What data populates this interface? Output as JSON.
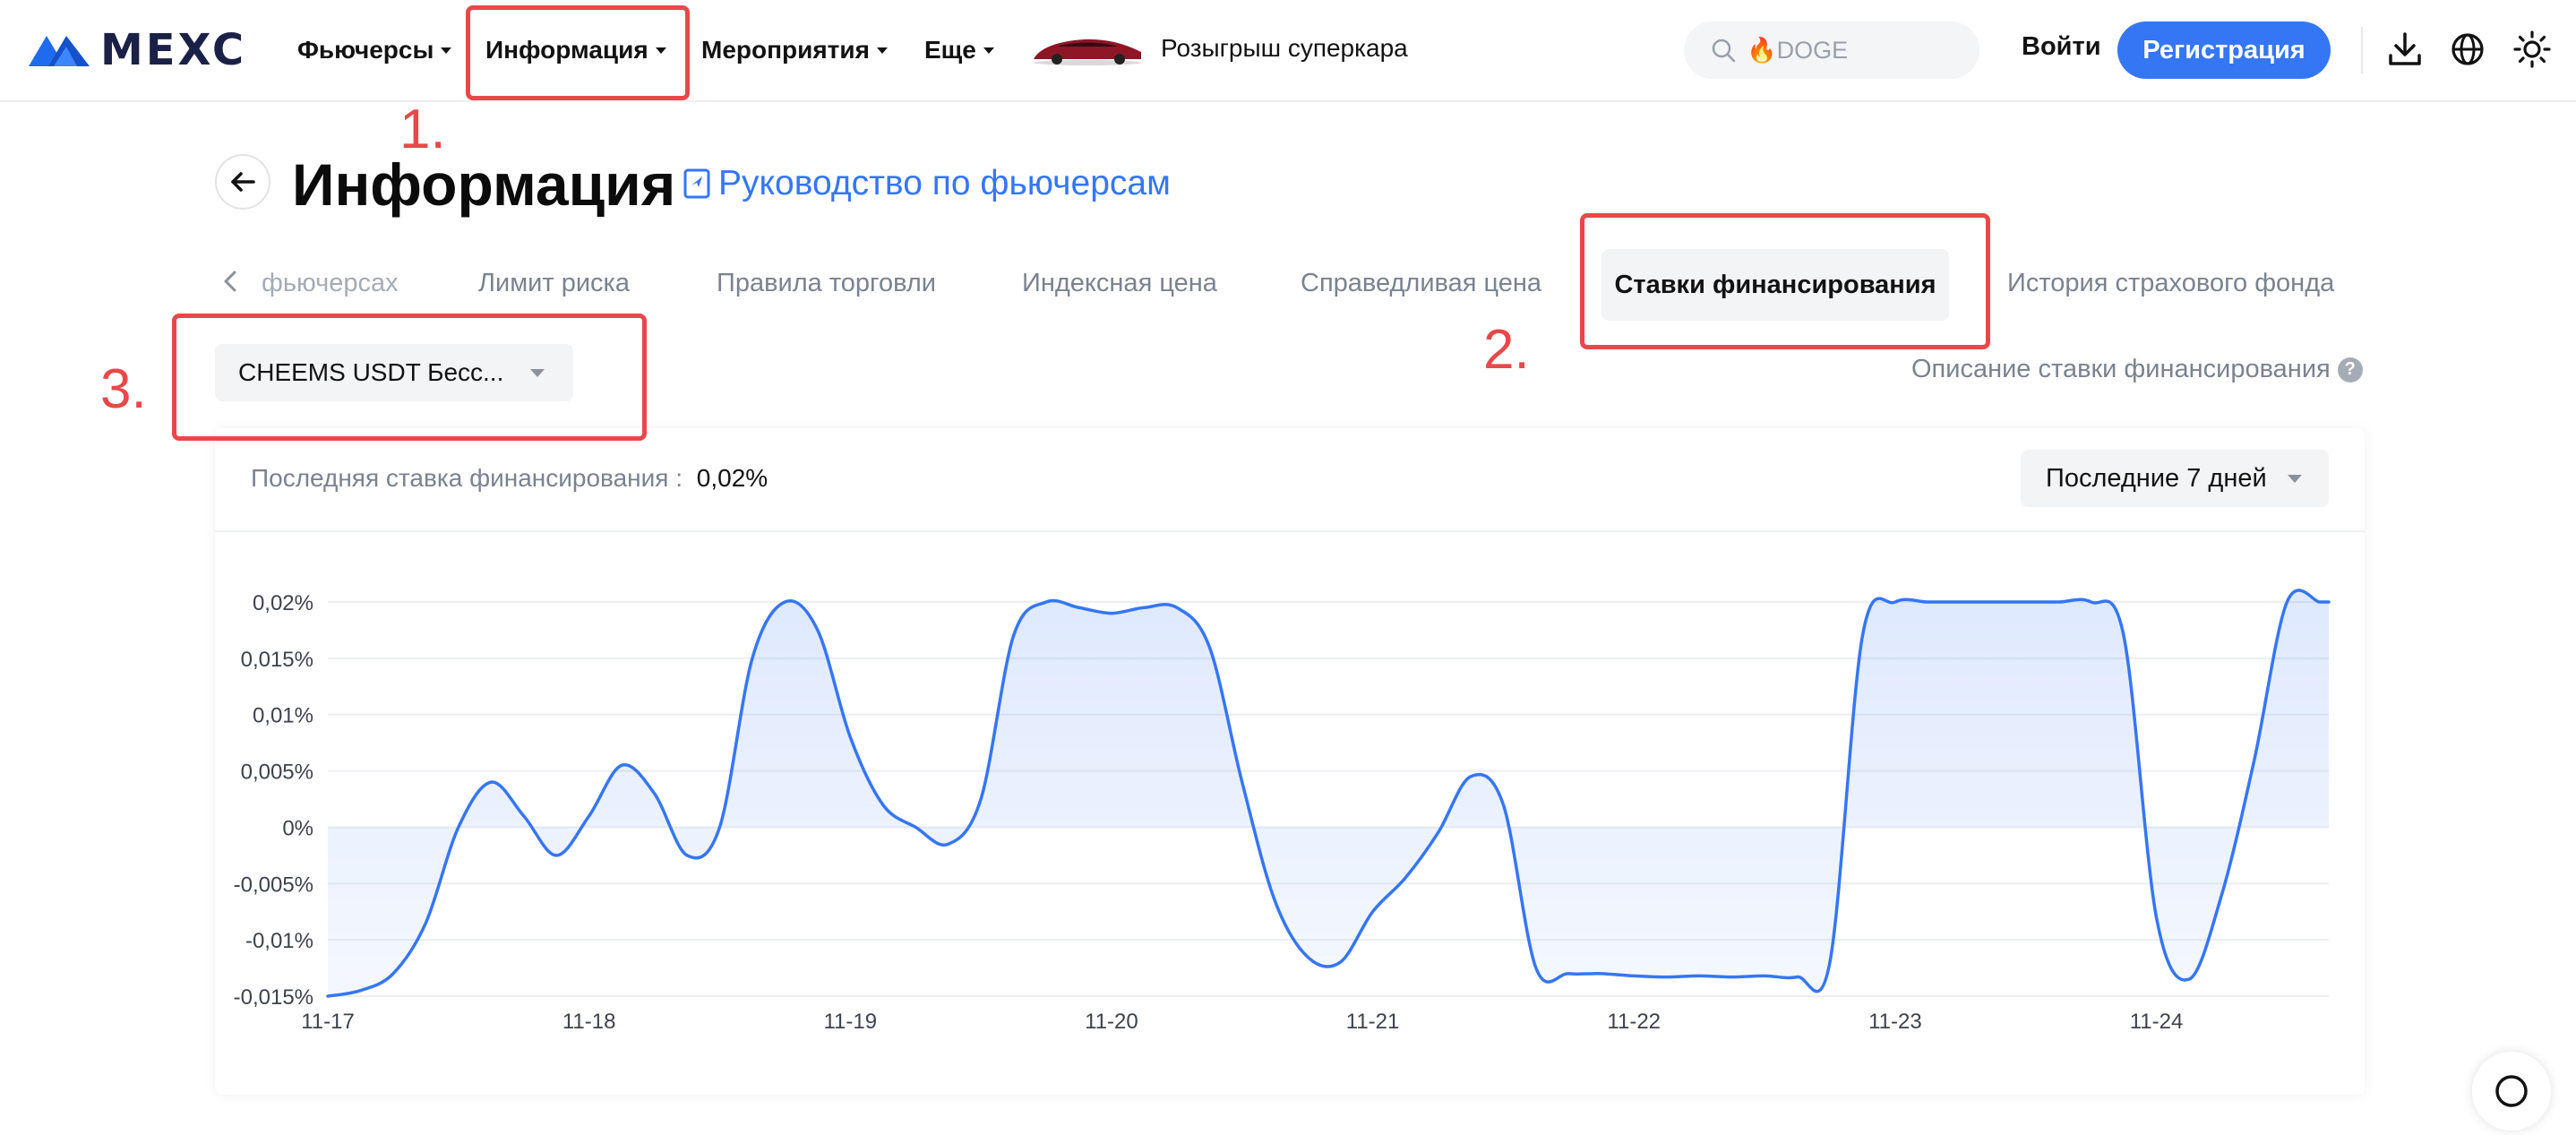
{
  "brand": {
    "logo_text": "MEXC",
    "accent": "#3576f5",
    "annotation_color": "#e8484a"
  },
  "nav": {
    "items": [
      {
        "label": "Фьючерсы"
      },
      {
        "label": "Информация"
      },
      {
        "label": "Мероприятия"
      },
      {
        "label": "Еще"
      }
    ],
    "promo_label": "Розыгрыш суперкара",
    "search_placeholder": "🔥DOGE",
    "login_label": "Войти",
    "register_label": "Регистрация",
    "icons": [
      "download-icon",
      "globe-icon",
      "theme-sun-icon"
    ]
  },
  "header": {
    "title": "Информация",
    "guide_link": "Руководство по фьючерсам"
  },
  "tabs": {
    "items": [
      {
        "label": "фьючерсах"
      },
      {
        "label": "Лимит риска"
      },
      {
        "label": "Правила торговли"
      },
      {
        "label": "Индексная цена"
      },
      {
        "label": "Справедливая цена"
      },
      {
        "label": "Ставки финансирования",
        "active": true
      },
      {
        "label": "История страхового фонда"
      }
    ]
  },
  "contract_select": {
    "value": "CHEEMS USDT Бесс..."
  },
  "funding_description_link": "Описание ставки финансирования",
  "last_rate": {
    "label": "Последняя ставка финансирования :",
    "value": "0,02%"
  },
  "period_select": {
    "value": "Последние 7 дней"
  },
  "annotations": [
    "1.",
    "2.",
    "3."
  ],
  "chart_data": {
    "type": "area",
    "x_tick_labels": [
      "11-17",
      "11-18",
      "11-19",
      "11-20",
      "11-21",
      "11-22",
      "11-23",
      "11-24"
    ],
    "y_tick_labels": [
      "0,02%",
      "0,015%",
      "0,01%",
      "0,005%",
      "0%",
      "-0,005%",
      "-0,01%",
      "-0,015%"
    ],
    "ylim": [
      -0.015,
      0.02
    ],
    "grid": true,
    "series": [
      {
        "color": "#3576f5",
        "x": [
          0,
          0.125,
          0.25,
          0.375,
          0.5,
          0.625,
          0.75,
          0.875,
          1.0,
          1.125,
          1.25,
          1.375,
          1.5,
          1.625,
          1.75,
          1.875,
          2.0,
          2.125,
          2.25,
          2.375,
          2.5,
          2.625,
          2.75,
          2.875,
          3.0,
          3.125,
          3.25,
          3.375,
          3.5,
          3.625,
          3.75,
          3.875,
          4.0,
          4.125,
          4.25,
          4.375,
          4.5,
          4.625,
          4.75,
          4.875,
          5.0,
          5.125,
          5.25,
          5.375,
          5.5,
          5.625,
          5.75,
          5.875,
          6.0,
          6.125,
          6.25,
          6.375,
          6.5,
          6.625,
          6.75,
          6.875,
          7.0,
          7.125,
          7.25,
          7.375,
          7.5,
          7.625,
          7.66
        ],
        "values": [
          -0.015,
          -0.0145,
          -0.013,
          -0.0085,
          0.0,
          0.004,
          0.001,
          -0.0025,
          0.001,
          0.0055,
          0.003,
          -0.0025,
          0.0,
          0.015,
          0.02,
          0.0175,
          0.008,
          0.002,
          0.0,
          -0.0015,
          0.0025,
          0.017,
          0.02,
          0.0195,
          0.019,
          0.0195,
          0.0195,
          0.016,
          0.004,
          -0.0065,
          -0.0115,
          -0.012,
          -0.0075,
          -0.0045,
          -0.0005,
          0.0045,
          0.002,
          -0.0125,
          -0.013,
          -0.013,
          -0.0132,
          -0.0133,
          -0.0132,
          -0.0133,
          -0.0132,
          -0.0133,
          -0.012,
          0.017,
          0.02,
          0.02,
          0.02,
          0.02,
          0.02,
          0.02,
          0.02,
          0.017,
          -0.008,
          -0.0135,
          -0.006,
          0.006,
          0.02,
          0.02,
          0.02
        ]
      }
    ]
  }
}
